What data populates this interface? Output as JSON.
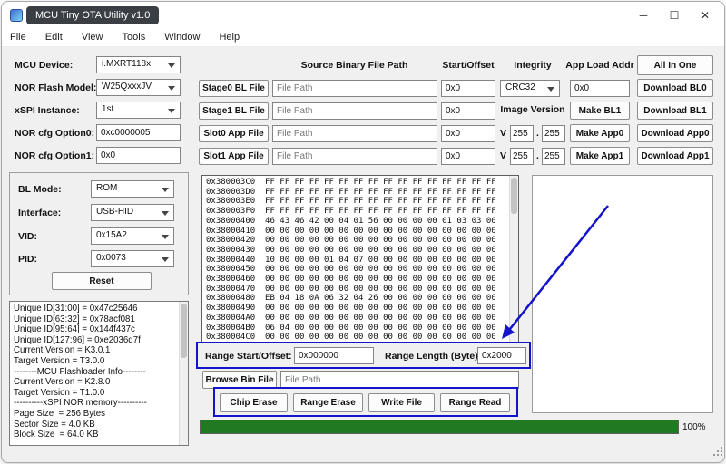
{
  "window": {
    "title": "MCU Tiny OTA Utility v1.0",
    "controls": {
      "minimize": "─",
      "maximize": "☐",
      "close": "✕"
    }
  },
  "menu": {
    "items": [
      "File",
      "Edit",
      "View",
      "Tools",
      "Window",
      "Help"
    ]
  },
  "device": {
    "rows": [
      {
        "label": "MCU Device:",
        "value": "i.MXRT118x"
      },
      {
        "label": "NOR Flash Model:",
        "value": "W25QxxxJV"
      },
      {
        "label": "xSPI Instance:",
        "value": "1st"
      },
      {
        "label": "NOR cfg Option0:",
        "value": "0xc0000005"
      },
      {
        "label": "NOR cfg Option1:",
        "value": "0x0"
      }
    ]
  },
  "connection": {
    "rows": [
      {
        "label": "BL Mode:",
        "value": "ROM"
      },
      {
        "label": "Interface:",
        "value": "USB-HID"
      },
      {
        "label": "VID:",
        "value": "0x15A2"
      },
      {
        "label": "PID:",
        "value": "0x0073"
      }
    ],
    "reset_label": "Reset"
  },
  "info": {
    "lines": [
      "Unique ID[31:00] = 0x47c25646",
      "Unique ID[63:32] = 0x78acf081",
      "Unique ID[95:64] = 0x144f437c",
      "Unique ID[127:96] = 0xe2036d7f",
      "Current Version = K3.0.1",
      "Target Version = T3.0.0",
      "--------MCU Flashloader Info--------",
      "Current Version = K2.8.0",
      "Target Version = T1.0.0",
      "----------xSPI NOR memory----------",
      "Page Size  = 256 Bytes",
      "Sector Size = 4.0 KB",
      "Block Size  = 64.0 KB"
    ]
  },
  "files": {
    "headers": {
      "source": "Source Binary File Path",
      "offset": "Start/Offset",
      "integrity": "Integrity",
      "load": "App Load Addr"
    },
    "all_in_one": "All In One",
    "version_prefix": "V",
    "version_separator": ".",
    "rows": [
      {
        "button": "Stage0 BL File",
        "path_placeholder": "File Path",
        "offset": "0x0",
        "integrity": "CRC32",
        "load": "0x0",
        "download": "Download BL0"
      },
      {
        "button": "Stage1 BL File",
        "path_placeholder": "File Path",
        "offset": "0x0",
        "integrity_label": "Image Version",
        "make": "Make BL1",
        "download": "Download BL1"
      },
      {
        "button": "Slot0 App File",
        "path_placeholder": "File Path",
        "offset": "0x0",
        "v_major": "255",
        "v_minor": "255",
        "make": "Make App0",
        "download": "Download App0"
      },
      {
        "button": "Slot1 App File",
        "path_placeholder": "File Path",
        "offset": "0x0",
        "v_major": "255",
        "v_minor": "255",
        "make": "Make App1",
        "download": "Download App1"
      }
    ]
  },
  "hex": {
    "lines": [
      "0x380003C0  FF FF FF FF FF FF FF FF FF FF FF FF FF FF FF FF",
      "0x380003D0  FF FF FF FF FF FF FF FF FF FF FF FF FF FF FF FF",
      "0x380003E0  FF FF FF FF FF FF FF FF FF FF FF FF FF FF FF FF",
      "0x380003F0  FF FF FF FF FF FF FF FF FF FF FF FF FF FF FF FF",
      "0x38000400  46 43 46 42 00 04 01 56 00 00 00 00 01 03 03 00",
      "0x38000410  00 00 00 00 00 00 00 00 00 00 00 00 00 00 00 00",
      "0x38000420  00 00 00 00 00 00 00 00 00 00 00 00 00 00 00 00",
      "0x38000430  00 00 00 00 00 00 00 00 00 00 00 00 00 00 00 00",
      "0x38000440  10 00 00 00 01 04 07 00 00 00 00 00 00 00 00 00",
      "0x38000450  00 00 00 00 00 00 00 00 00 00 00 00 00 00 00 00",
      "0x38000460  00 00 00 00 00 00 00 00 00 00 00 00 00 00 00 00",
      "0x38000470  00 00 00 00 00 00 00 00 00 00 00 00 00 00 00 00",
      "0x38000480  EB 04 18 0A 06 32 04 26 00 00 00 00 00 00 00 00",
      "0x38000490  00 00 00 00 00 00 00 00 00 00 00 00 00 00 00 00",
      "0x380004A0  00 00 00 00 00 00 00 00 00 00 00 00 00 00 00 00",
      "0x380004B0  06 04 00 00 00 00 00 00 00 00 00 00 00 00 00 00",
      "0x380004C0  00 00 00 00 00 00 00 00 00 00 00 00 00 00 00 00"
    ]
  },
  "range": {
    "start_label": "Range Start/Offset:",
    "start_value": "0x000000",
    "length_label": "Range Length (Byte):",
    "length_value": "0x2000"
  },
  "browse": {
    "button": "Browse Bin File",
    "path_placeholder": "File Path"
  },
  "actions": {
    "labels": [
      "Chip Erase",
      "Range Erase",
      "Write File",
      "Range Read"
    ]
  },
  "progress": {
    "value": 100,
    "label": "100%",
    "color": "#217a21"
  },
  "annotation": {
    "color": "#1414cc"
  }
}
